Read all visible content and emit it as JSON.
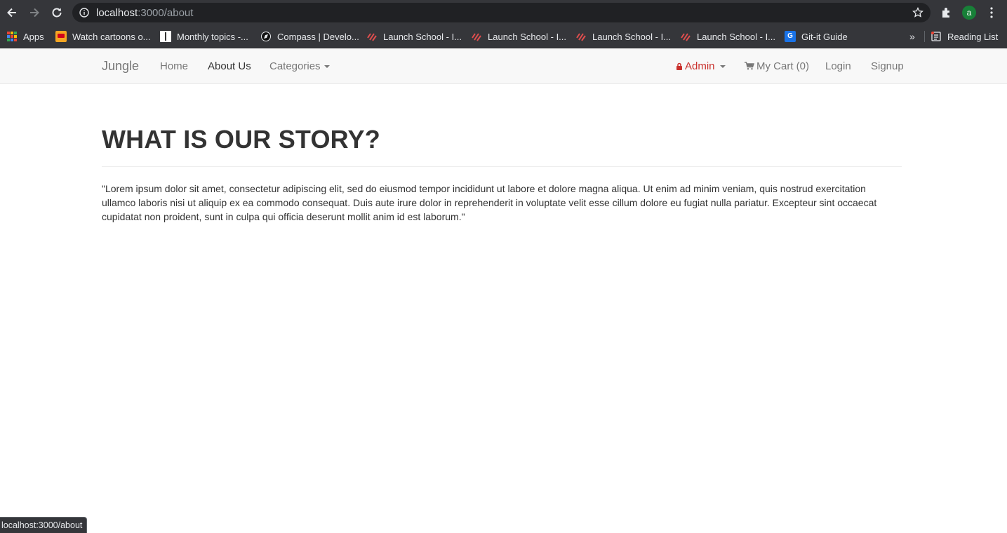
{
  "browser": {
    "url_host": "localhost",
    "url_path": ":3000/about",
    "avatar_letter": "a",
    "bookmarks": [
      {
        "label": "Apps",
        "icon": "apps-grid-icon"
      },
      {
        "label": "Watch cartoons o...",
        "icon": "cartoon-favicon"
      },
      {
        "label": "Monthly topics -...",
        "icon": "doc-favicon"
      },
      {
        "label": "Compass | Develo...",
        "icon": "compass-favicon"
      },
      {
        "label": "Launch School - I...",
        "icon": "launch-school-favicon"
      },
      {
        "label": "Launch School - I...",
        "icon": "launch-school-favicon"
      },
      {
        "label": "Launch School - I...",
        "icon": "launch-school-favicon"
      },
      {
        "label": "Launch School - I...",
        "icon": "launch-school-favicon"
      },
      {
        "label": "Git-it Guide",
        "icon": "git-it-favicon"
      }
    ],
    "more_bookmarks": "»",
    "reading_list": "Reading List",
    "status_url": "localhost:3000/about"
  },
  "site_nav": {
    "brand": "Jungle",
    "home": "Home",
    "about": "About Us",
    "categories": "Categories",
    "admin": "Admin",
    "cart": "My Cart (0)",
    "login": "Login",
    "signup": "Signup"
  },
  "main": {
    "title": "WHAT IS OUR STORY?",
    "body": "\"Lorem ipsum dolor sit amet, consectetur adipiscing elit, sed do eiusmod tempor incididunt ut labore et dolore magna aliqua. Ut enim ad minim veniam, quis nostrud exercitation ullamco laboris nisi ut aliquip ex ea commodo consequat. Duis aute irure dolor in reprehenderit in voluptate velit esse cillum dolore eu fugiat nulla pariatur. Excepteur sint occaecat cupidatat non proident, sunt in culpa qui officia deserunt mollit anim id est laborum.\""
  },
  "colors": {
    "navbar_bg": "#f8f8f8",
    "admin_red": "#c9302c",
    "chrome_dark": "#35363a"
  }
}
